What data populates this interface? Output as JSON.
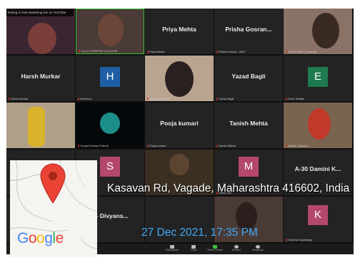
{
  "banner": "leeting is now streaming live on YouTube",
  "participants": {
    "r1c1": "",
    "r1c2": "LALA LAJPATRAI COLLEGE",
    "r1c3": "Priya Mehta",
    "r1c4": "Prisha Gosran...",
    "r1c4_label": "Prisha Gosran - BAF",
    "r1c5": "Trisha Sinha (Sharma)",
    "r2c1": "Harsh Murkar",
    "r2c1_label": "Harsh Murkar",
    "r2c2_initial": "H",
    "r2c2_label": "Hamza A",
    "r2c3": "Ananya Kulkarni",
    "r2c4": "Yazad Bagli",
    "r2c4_label": "Yazad Bagli",
    "r2c5_initial": "E",
    "r2c5_label": "Eram Shaikh",
    "r3c2": "Gurjeet Dubey Fullonh",
    "r3c3": "Pooja kumari",
    "r3c3_label": "Pooja kumari",
    "r3c4": "Tanish Mehta",
    "r3c4_label": "Tanish Mehta",
    "r3c5": "Sakshi Salvekar",
    "r4c2_initial": "S",
    "r4c2_label": "Lata College",
    "r4c4_initial": "M",
    "r4c4_label": "Manu Jain",
    "r4c5": "A-30 Damini K...",
    "r5c2": "B- Divyans...",
    "r5c5_initial": "K",
    "r5c5_label": "Khushal Upadhyay"
  },
  "toolbar": [
    "Participants",
    "Chat",
    "Share Screen",
    "Record",
    "Reactions"
  ],
  "stamp": {
    "address": "Kasavan Rd, Vagade, Maharashtra 416602, India",
    "datetime": "27 Dec 2021, 17:35 PM"
  },
  "map": {
    "logo": "Google"
  },
  "colors": {
    "accent_green": "#3ec13e",
    "stamp_time": "#3fa9f5",
    "pin": "#ea4335"
  }
}
